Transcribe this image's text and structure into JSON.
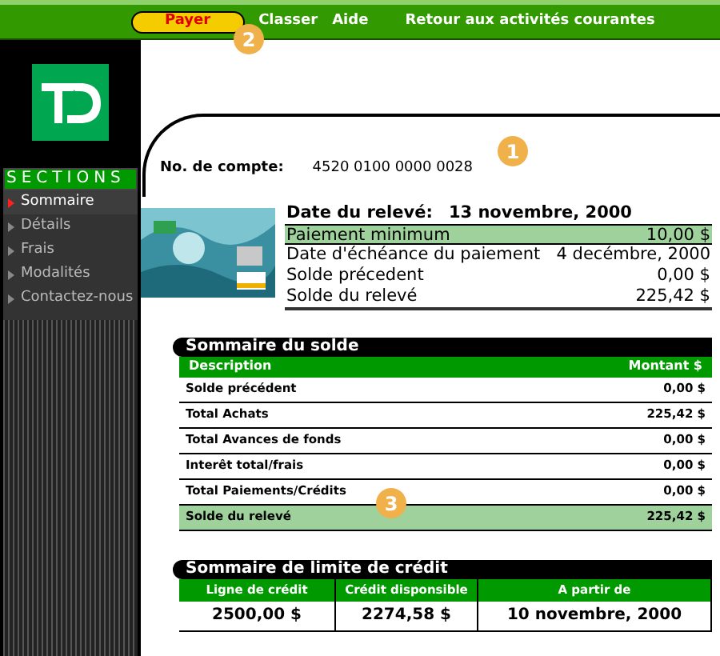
{
  "menu": [
    {
      "label": "Payer",
      "selected": true
    },
    {
      "label": "Classer",
      "selected": false
    },
    {
      "label": "Aide",
      "selected": false
    },
    {
      "label": "Retour aux activités courantes",
      "selected": false
    }
  ],
  "sidebar": {
    "heading": "SECTIONS",
    "items": [
      {
        "label": "Sommaire",
        "selected": true
      },
      {
        "label": "Détails",
        "selected": false
      },
      {
        "label": "Frais",
        "selected": false
      },
      {
        "label": "Modalités",
        "selected": false
      },
      {
        "label": "Contactez-nous",
        "selected": false
      }
    ]
  },
  "account": {
    "label": "No. de compte:",
    "value": "4520 0100 0000 0028"
  },
  "statement": [
    {
      "label": "Date du relevé:",
      "value": "13 novembre, 2000",
      "highlighted": false
    },
    {
      "label": "Paiement minimum",
      "value": "10,00 $",
      "highlighted": true
    },
    {
      "label": "Date d'échéance du paiement",
      "value": "4 decémbre, 2000",
      "highlighted": false
    },
    {
      "label": "Solde précedent",
      "value": "0,00 $",
      "highlighted": false
    },
    {
      "label": "Solde du relevé",
      "value": "225,42 $",
      "highlighted": false
    }
  ],
  "balance_summary": {
    "title": "Sommaire du solde",
    "columns": [
      "Description",
      "Montant $"
    ],
    "rows": [
      {
        "label": "Solde précédent",
        "value": "0,00 $",
        "highlighted": false
      },
      {
        "label": "Total Achats",
        "value": "225,42 $",
        "highlighted": false
      },
      {
        "label": "Total Avances de fonds",
        "value": "0,00 $",
        "highlighted": false
      },
      {
        "label": "Interêt total/frais",
        "value": "0,00 $",
        "highlighted": false
      },
      {
        "label": "Total Paiements/Crédits",
        "value": "0,00 $",
        "highlighted": false
      },
      {
        "label": "Solde du relevé",
        "value": "225,42 $",
        "highlighted": true
      }
    ]
  },
  "credit_summary": {
    "title": "Sommaire de limite de crédit",
    "columns": [
      "Ligne de crédit",
      "Crédit disponsible",
      "A partir de"
    ],
    "values": [
      "2500,00 $",
      "2274,58 $",
      "10 novembre, 2000"
    ]
  },
  "callouts": [
    "1",
    "2",
    "3"
  ]
}
